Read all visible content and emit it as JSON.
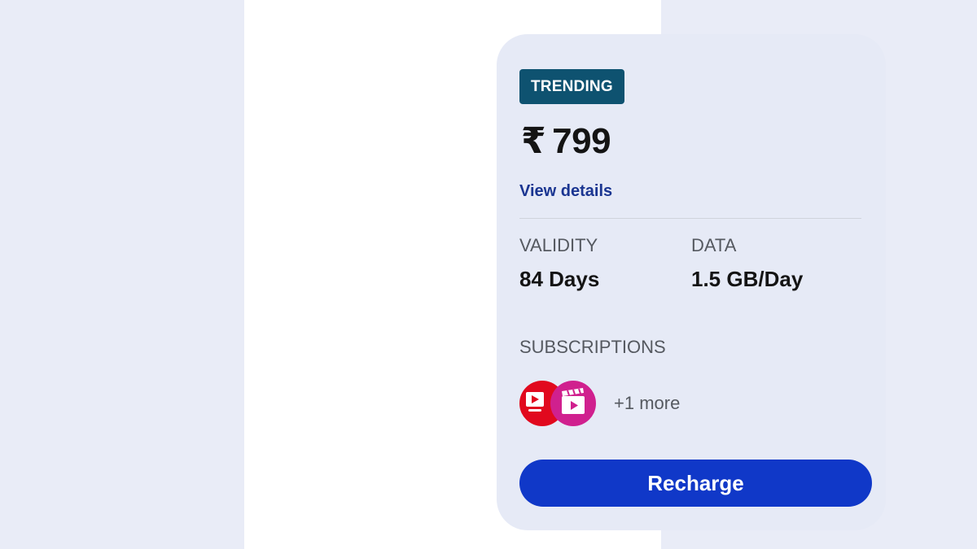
{
  "plan": {
    "badge": "TRENDING",
    "currency_symbol": "₹",
    "price": "799",
    "view_details_label": "View details",
    "stats": [
      {
        "label": "VALIDITY",
        "value": "84 Days"
      },
      {
        "label": "DATA",
        "value": "1.5 GB/Day"
      }
    ],
    "subscriptions": {
      "label": "SUBSCRIPTIONS",
      "icons": [
        "tv-play-icon",
        "clapperboard-icon"
      ],
      "more_text": "+1 more"
    },
    "recharge_label": "Recharge"
  },
  "colors": {
    "background": "#e9ecf7",
    "panel": "#ffffff",
    "card": "#e6eaf6",
    "badge": "#0e5270",
    "link": "#1a3591",
    "button": "#1038c8",
    "tv_icon_bg": "#e1091e",
    "cinema_icon_bg": "#d0208e"
  }
}
